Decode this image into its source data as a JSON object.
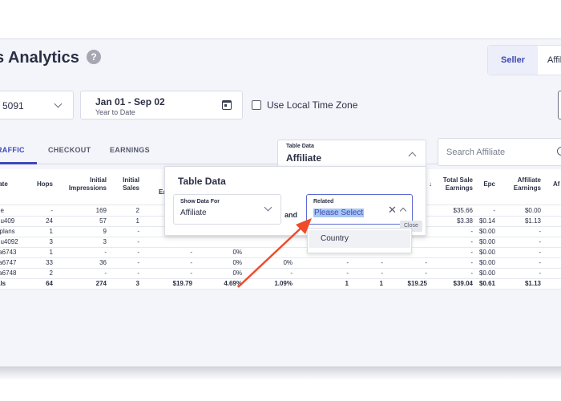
{
  "header": {
    "title": "s Analytics",
    "help_glyph": "?",
    "view_toggle": {
      "seller": "Seller",
      "affiliate": "Affil"
    }
  },
  "filters": {
    "vendor_value": "5091",
    "date_range": "Jan 01 - Sep 02",
    "date_preset": "Year to Date",
    "local_tz_label": "Use Local Time Zone"
  },
  "tabs": [
    {
      "label": "RAFFIC",
      "active": true
    },
    {
      "label": "CHECKOUT",
      "active": false
    },
    {
      "label": "EARNINGS",
      "active": false
    }
  ],
  "table_data_select": {
    "label": "Table Data",
    "value": "Affiliate"
  },
  "search": {
    "placeholder": "Search Affiliate"
  },
  "table": {
    "headers": {
      "affiliate": "iate",
      "hops": "Hops",
      "initial_impressions": "Initial Impressions",
      "initial_sales": "Initial Sales",
      "partial": "Ea",
      "sort_arrow": "↓",
      "total_sale_earnings": "Total Sale Earnings",
      "epc": "Epc",
      "affiliate_earnings": "Affiliate Earnings",
      "last": "Af"
    },
    "rows": [
      {
        "affiliate": "ne",
        "hops": "-",
        "impressions": "169",
        "sales": "2",
        "c5": "",
        "c6": "",
        "c7": "",
        "c8": "",
        "c9": "",
        "c10": "",
        "total": "$35.66",
        "epc": "-",
        "aff": "$0.00"
      },
      {
        "affiliate": "nu409",
        "hops": "24",
        "impressions": "57",
        "sales": "1",
        "c5": "",
        "c6": "",
        "c7": "",
        "c8": "",
        "c9": "",
        "c10": "",
        "total": "$3.38",
        "epc": "$0.14",
        "aff": "$1.13"
      },
      {
        "affiliate": "llplans",
        "hops": "1",
        "impressions": "9",
        "sales": "-",
        "c5": "",
        "c6": "",
        "c7": "",
        "c8": "",
        "c9": "",
        "c10": "",
        "total": "-",
        "epc": "$0.00",
        "aff": "-"
      },
      {
        "affiliate": "nu4092",
        "hops": "3",
        "impressions": "3",
        "sales": "-",
        "c5": "",
        "c6": "",
        "c7": "",
        "c8": "",
        "c9": "",
        "c10": "",
        "total": "-",
        "epc": "$0.00",
        "aff": "-"
      },
      {
        "affiliate": "ta6743",
        "hops": "1",
        "impressions": "-",
        "sales": "-",
        "c5": "-",
        "c6": "0%",
        "c7": "",
        "c8": "",
        "c9": "",
        "c10": "",
        "total": "-",
        "epc": "$0.00",
        "aff": "-"
      },
      {
        "affiliate": "ta6747",
        "hops": "33",
        "impressions": "36",
        "sales": "-",
        "c5": "-",
        "c6": "0%",
        "c7": "0%",
        "c8": "-",
        "c9": "-",
        "c10": "-",
        "total": "-",
        "epc": "$0.00",
        "aff": "-"
      },
      {
        "affiliate": "ta6748",
        "hops": "2",
        "impressions": "-",
        "sales": "-",
        "c5": "-",
        "c6": "0%",
        "c7": "-",
        "c8": "-",
        "c9": "-",
        "c10": "-",
        "total": "-",
        "epc": "$0.00",
        "aff": "-"
      }
    ],
    "totals": {
      "affiliate": "als",
      "hops": "64",
      "impressions": "274",
      "sales": "3",
      "c5": "$19.79",
      "c6": "4.69%",
      "c7": "1.09%",
      "c8": "1",
      "c9": "1",
      "c10": "$19.25",
      "total": "$39.04",
      "epc": "$0.61",
      "aff": "$1.13"
    }
  },
  "overlay": {
    "title": "Table Data",
    "show_for": {
      "label": "Show Data For",
      "value": "Affiliate"
    },
    "and_text": "and",
    "related": {
      "label": "Related",
      "value": "Please Select"
    },
    "clear_glyph": "✕",
    "tooltip": "Close",
    "options": [
      "Country"
    ]
  },
  "colors": {
    "accent": "#3c48b8",
    "annotation_arrow": "#f04a28",
    "highlight": "#a9c8f2"
  }
}
